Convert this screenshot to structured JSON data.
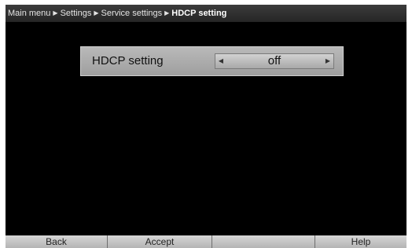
{
  "breadcrumb": {
    "items": [
      "Main menu",
      "Settings",
      "Service settings",
      "HDCP setting"
    ],
    "separator": "▶"
  },
  "setting": {
    "label": "HDCP setting",
    "value": "off",
    "left_arrow": "◀",
    "right_arrow": "▶"
  },
  "soft_buttons": {
    "back": "Back",
    "accept": "Accept",
    "blank": "",
    "help": "Help"
  },
  "colors": {
    "screen_background": "#000000",
    "panel_background": "#b0b0b0",
    "soft_button_background": "#c8c8c8",
    "title_text": "#e4e4e4"
  },
  "icons": {
    "selector_left": "triangle-left-icon",
    "selector_right": "triangle-right-icon",
    "breadcrumb_separator": "triangle-right-icon"
  }
}
